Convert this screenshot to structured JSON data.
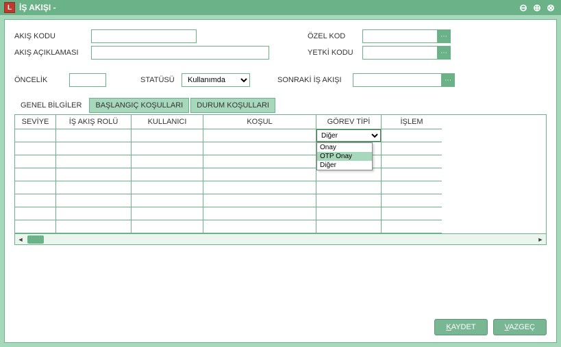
{
  "titlebar": {
    "title": "İŞ AKIŞI -",
    "icon_letter": "L"
  },
  "form": {
    "akis_kodu_label": "AKIŞ KODU",
    "akis_kodu_value": "",
    "akis_aciklamasi_label": "AKIŞ AÇIKLAMASI",
    "akis_aciklamasi_value": "",
    "ozel_kod_label": "ÖZEL KOD",
    "ozel_kod_value": "",
    "yetki_kodu_label": "YETKİ KODU",
    "yetki_kodu_value": "",
    "oncelik_label": "ÖNCELİK",
    "oncelik_value": "",
    "statusu_label": "STATÜSÜ",
    "statusu_value": "Kullanımda",
    "sonraki_label": "SONRAKİ İŞ AKIŞI",
    "sonraki_value": ""
  },
  "tabs": {
    "genel": "GENEL BİLGİLER",
    "baslangic": "BAŞLANGIÇ KOŞULLARI",
    "durum": "DURUM KOŞULLARI"
  },
  "grid": {
    "headers": {
      "seviye": "SEVİYE",
      "rol": "İŞ AKIŞ ROLÜ",
      "kullanici": "KULLANICI",
      "kosul": "KOŞUL",
      "gorev": "GÖREV TİPİ",
      "islem": "İŞLEM"
    },
    "gorev_selected": "Diğer",
    "gorev_options": {
      "onay": "Onay",
      "otp_onay": "OTP Onay",
      "diger": "Diğer"
    }
  },
  "footer": {
    "kaydet_prefix": "K",
    "kaydet_rest": "AYDET",
    "vazgec_prefix": "V",
    "vazgec_rest": "AZGEÇ"
  }
}
